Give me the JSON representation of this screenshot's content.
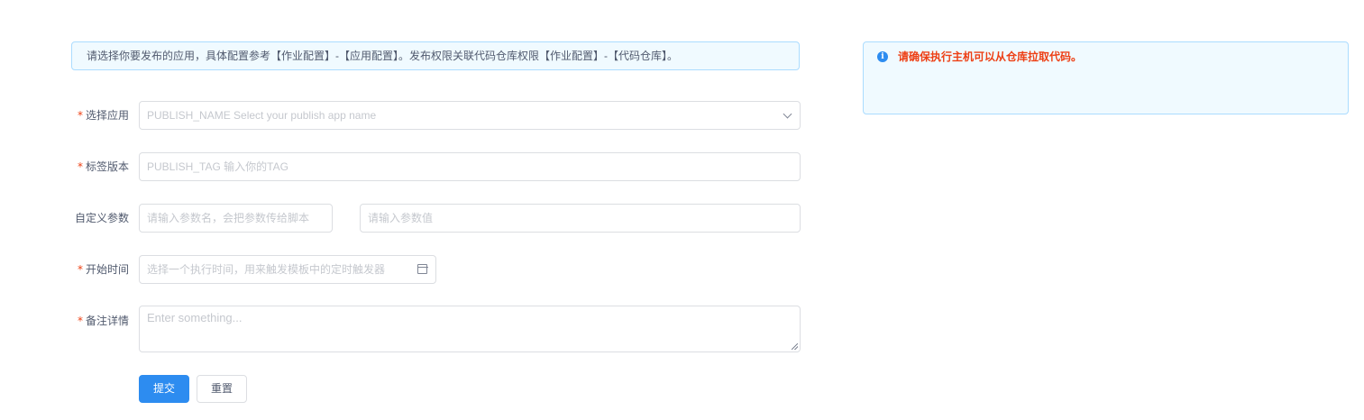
{
  "info_alert": {
    "text": "请选择你要发布的应用，具体配置参考【作业配置】-【应用配置】。发布权限关联代码仓库权限【作业配置】-【代码仓库】。"
  },
  "warning_alert": {
    "icon": "info-icon",
    "text": "请确保执行主机可以从仓库拉取代码。",
    "color": "#ed3f14"
  },
  "form": {
    "required_mark": "*",
    "app": {
      "label": "选择应用",
      "placeholder": "PUBLISH_NAME Select your publish app name"
    },
    "tag": {
      "label": "标签版本",
      "placeholder": "PUBLISH_TAG  输入你的TAG"
    },
    "params": {
      "label": "自定义参数",
      "name_placeholder": "请输入参数名，会把参数传给脚本",
      "value_placeholder": "请输入参数值"
    },
    "start_time": {
      "label": "开始时间",
      "placeholder": "选择一个执行时间，用来触发模板中的定时触发器"
    },
    "remark": {
      "label": "备注详情",
      "placeholder": "Enter something..."
    },
    "submit_label": "提交",
    "reset_label": "重置"
  },
  "colors": {
    "primary": "#2d8cf0",
    "required": "#ed4014",
    "alert_bg": "#f0faff",
    "alert_border": "#abdcff"
  }
}
